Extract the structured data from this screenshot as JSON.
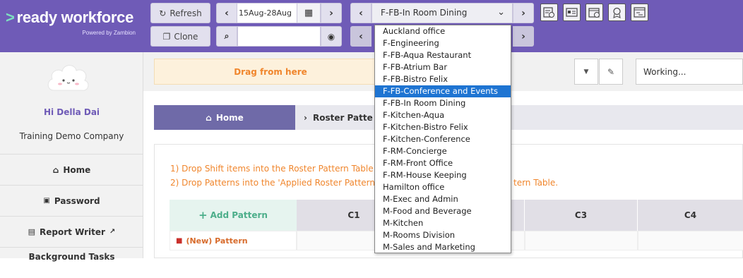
{
  "brand": {
    "name": "ready workforce",
    "tagline": "Powered by Zambion",
    "accent": "#6f5bb7"
  },
  "toolbar": {
    "refresh_label": "Refresh",
    "clone_label": "Clone",
    "date_range": "15Aug-28Aug",
    "location_selected": "F-FB-In Room Dining"
  },
  "sidebar": {
    "greeting": "Hi Della Dai",
    "company": "Training Demo Company",
    "items": [
      {
        "label": "Home"
      },
      {
        "label": "Password"
      },
      {
        "label": "Report Writer"
      },
      {
        "label": "Background Tasks"
      }
    ]
  },
  "main": {
    "drag_label": "Drag from here",
    "status": "Working...",
    "breadcrumb": {
      "home": "Home",
      "current": "Roster Patte"
    },
    "instructions": [
      "1) Drop Shift items into the Roster Pattern Table",
      "2) Drop Patterns into the 'Applied Roster Pattern"
    ],
    "instruction_tail": "tern Table.",
    "add_pattern": "Add Pattern",
    "columns": [
      "C1",
      "C3",
      "C4"
    ],
    "new_pattern": "(New) Pattern"
  },
  "dropdown": {
    "selected": "F-FB-Conference and Events",
    "options": [
      "Auckland office",
      "F-Engineering",
      "F-FB-Aqua Restaurant",
      "F-FB-Atrium Bar",
      "F-FB-Bistro Felix",
      "F-FB-Conference and Events",
      "F-FB-In Room Dining",
      "F-Kitchen-Aqua",
      "F-Kitchen-Bistro Felix",
      "F-Kitchen-Conference",
      "F-RM-Concierge",
      "F-RM-Front Office",
      "F-RM-House Keeping",
      "Hamilton office",
      "M-Exec and Admin",
      "M-Food and Beverage",
      "M-Kitchen",
      "M-Rooms Division",
      "M-Sales and Marketing"
    ]
  }
}
